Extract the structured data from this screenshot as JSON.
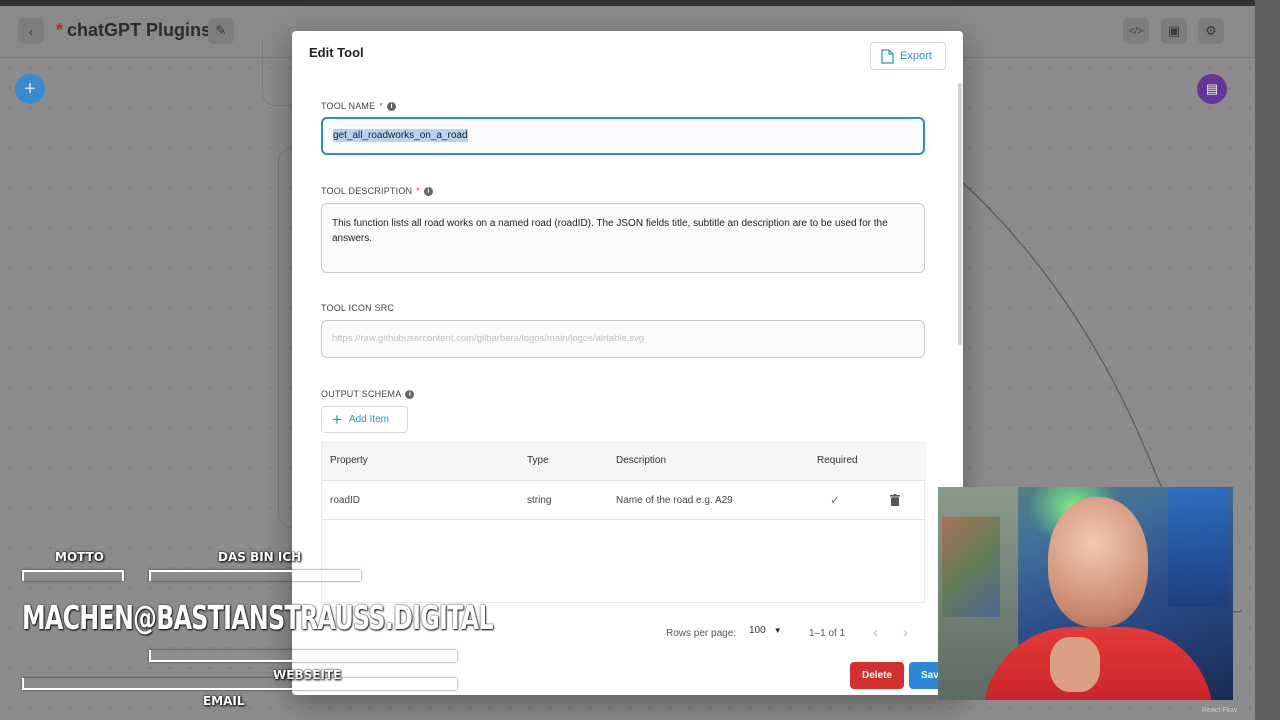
{
  "app": {
    "title": "chatGPT Plugins",
    "unsaved_marker": "*"
  },
  "modal": {
    "title": "Edit Tool",
    "export_label": "Export",
    "tool_name": {
      "label": "TOOL NAME",
      "required": "*",
      "value": "get_all_roadworks_on_a_road"
    },
    "tool_description": {
      "label": "TOOL DESCRIPTION",
      "required": "*",
      "value": "This function lists all road works on a named road (roadID). The JSON fields title, subtitle an description are to be used for the answers."
    },
    "tool_icon_src": {
      "label": "TOOL ICON SRC",
      "placeholder": "https://raw.githubusercontent.com/gilbarbara/logos/main/logos/airtable.svg"
    },
    "output_schema": {
      "label": "OUTPUT SCHEMA",
      "add_item_label": "Add Item",
      "columns": [
        "Property",
        "Type",
        "Description",
        "Required"
      ],
      "rows": [
        {
          "property": "roadID",
          "type": "string",
          "description": "Name of the road e.g. A29",
          "required": "✓"
        }
      ]
    },
    "pagination": {
      "rows_per_page_label": "Rows per page:",
      "rows_per_page_value": "100",
      "range": "1–1 of 1"
    },
    "delete_label": "Delete",
    "save_label": "Save"
  },
  "overlay": {
    "motto": "MOTTO",
    "das_bin_ich": "DAS BIN ICH",
    "email_address": "MACHEN@BASTIANSTRAUSS.DIGITAL",
    "webseite": "WEBSEITE",
    "email": "EMAIL"
  },
  "watermark": "React Flow",
  "colors": {
    "accent": "#2d86d8",
    "danger": "#d32f2f",
    "fab_add": "#1e88e5",
    "fab_chat": "#5b2a9a"
  }
}
